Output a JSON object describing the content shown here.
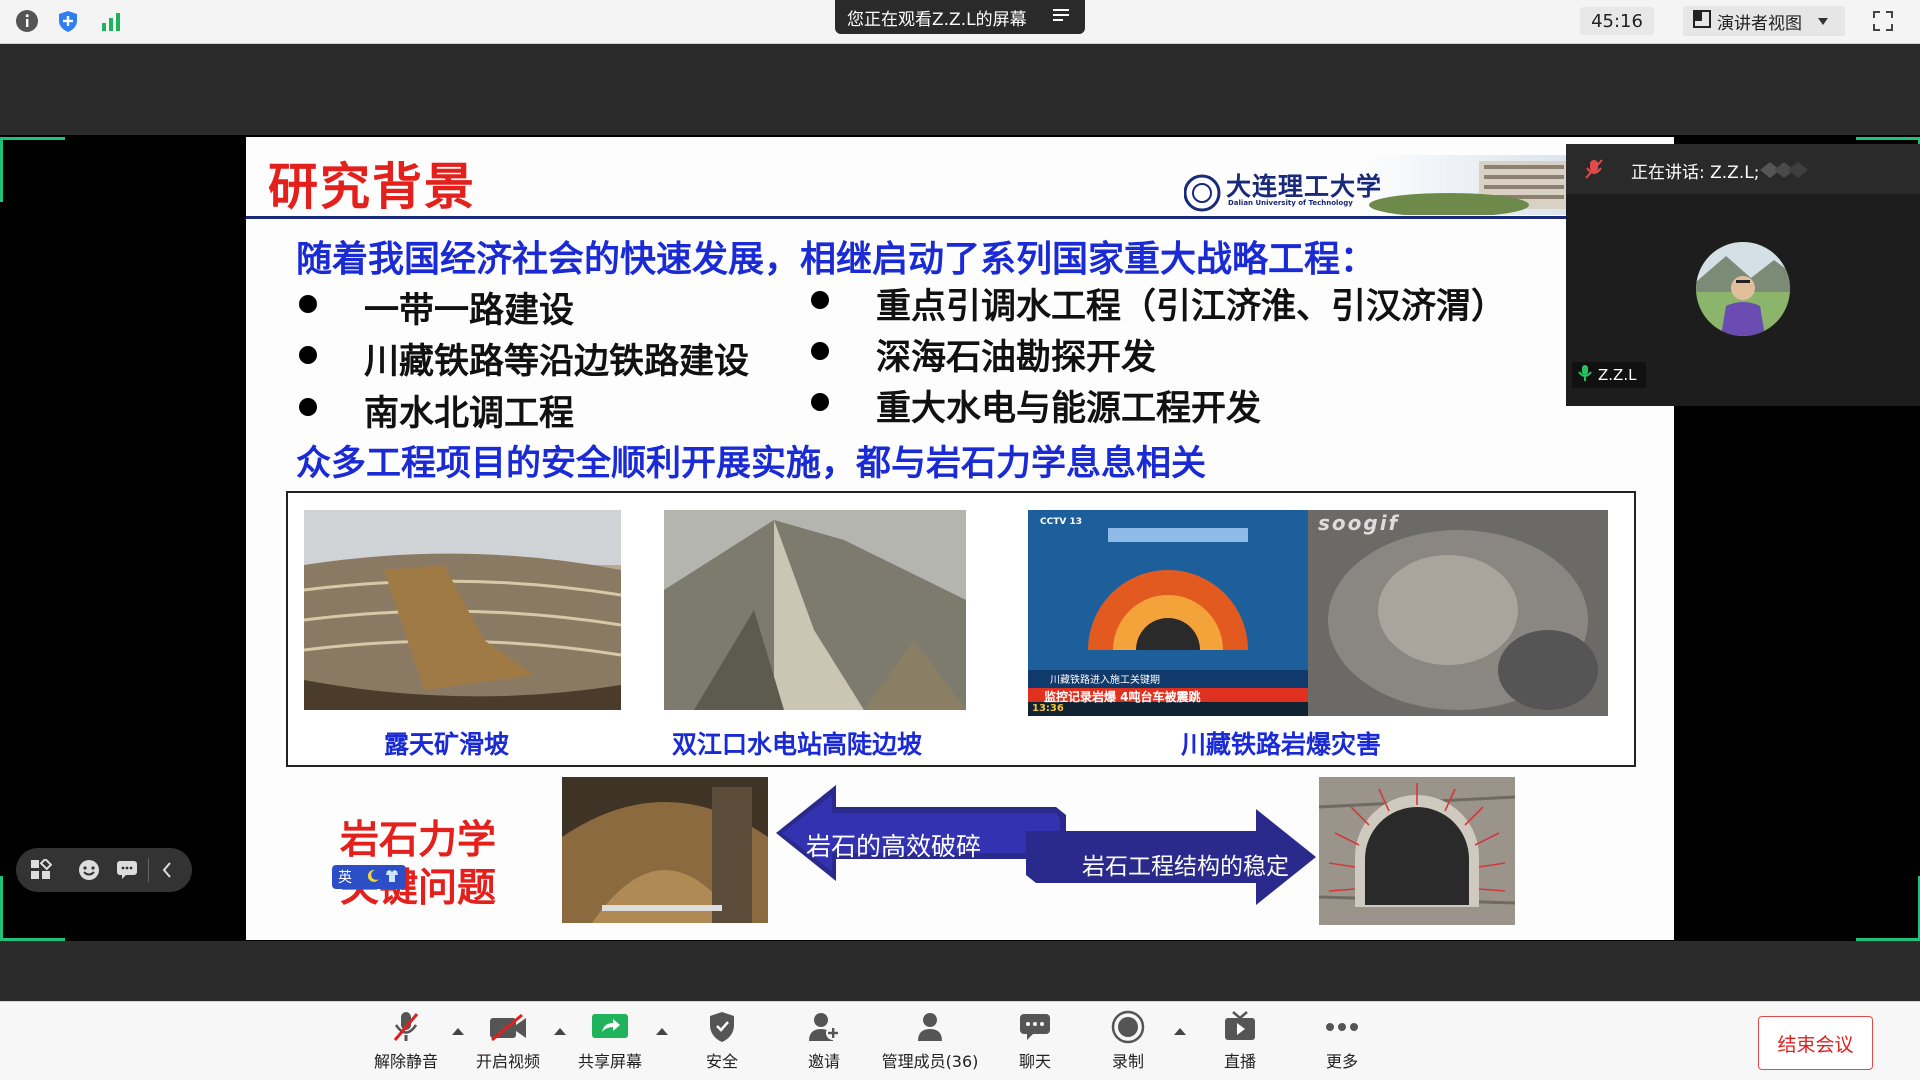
{
  "topbar": {
    "watching_text": "您正在观看Z.Z.L的屏幕",
    "timer": "45:16",
    "view_mode": "演讲者视图"
  },
  "slide": {
    "title": "研究背景",
    "logo_text": "大连理工大学",
    "logo_subtext": "Dalian University of Technology",
    "intro": "随着我国经济社会的快速发展，相继启动了系列国家重大战略工程：",
    "bullets_left": [
      "一带一路建设",
      "川藏铁路等沿边铁路建设",
      "南水北调工程"
    ],
    "bullets_right": [
      "重点引调水工程（引江济淮、引汉济渭）",
      "深海石油勘探开发",
      "重大水电与能源工程开发"
    ],
    "conclusion": "众多工程项目的安全顺利开展实施，都与岩石力学息息相关",
    "captions": [
      "露天矿滑坡",
      "双江口水电站高陡边坡",
      "川藏铁路岩爆灾害"
    ],
    "cctv_label": "CCTV 13",
    "gif_label": "soogif",
    "news_banner": "监控记录岩爆 4吨台车被震跳",
    "news_ticker": "13:36",
    "news_top": "川藏铁路进入施工关键期",
    "rock_label_1": "岩石力学",
    "rock_label_2": "关键问题",
    "arrow_left": "岩石的高效破碎",
    "arrow_right": "岩石工程结构的稳定",
    "ime_label": "英"
  },
  "speaker": {
    "talking": "正在讲话: Z.Z.L;",
    "name": "Z.Z.L"
  },
  "toolbar": {
    "unmute": "解除静音",
    "video": "开启视频",
    "share": "共享屏幕",
    "security": "安全",
    "invite": "邀请",
    "participants": "管理成员(36)",
    "chat": "聊天",
    "record": "录制",
    "live": "直播",
    "more": "更多",
    "end": "结束会议"
  }
}
